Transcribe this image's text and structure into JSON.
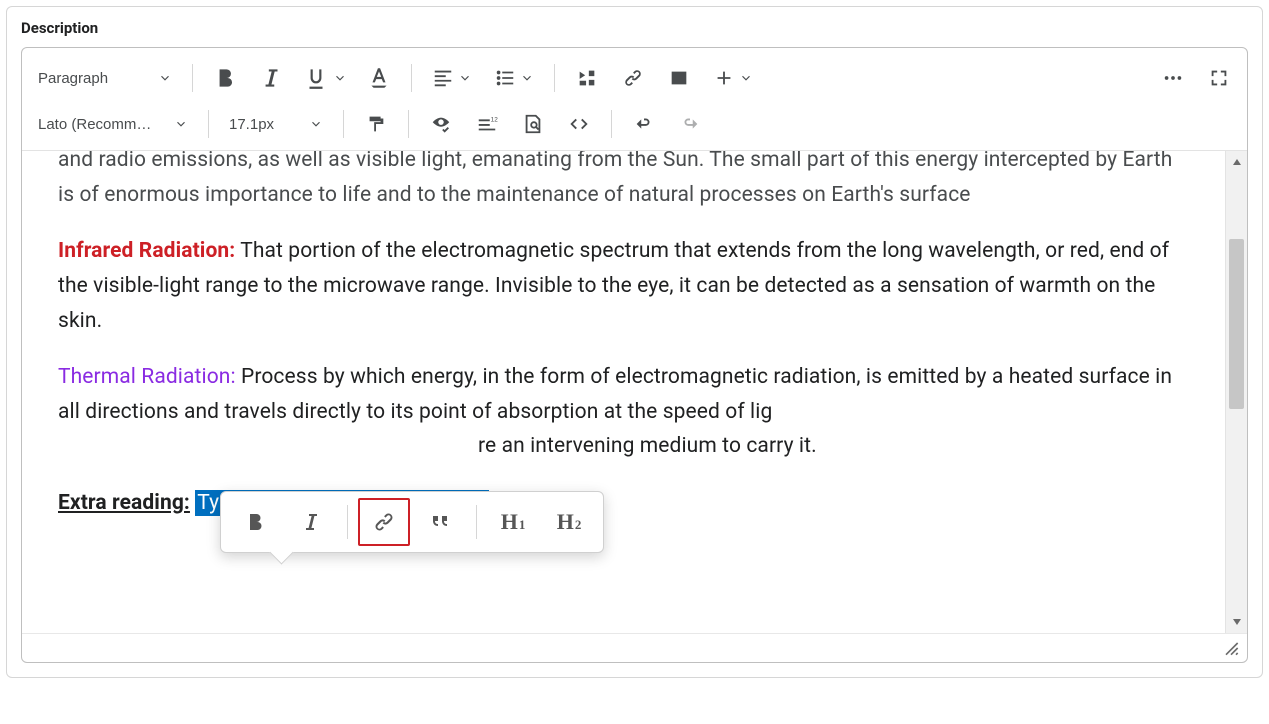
{
  "field_label": "Description",
  "toolbar": {
    "block_format": "Paragraph",
    "font_family": "Lato (Recommended)",
    "font_size": "17.1px"
  },
  "content": {
    "partial_top": "and radio emissions, as well as visible light, emanating from the Sun. The small part of this energy intercepted by Earth is of enormous importance to life and to the maintenance of natural processes on Earth's surface",
    "infrared_label": "Infrared Radiation:",
    "infrared_body": " That portion of the electromagnetic spectrum that extends from the long wavelength, or red, end of the visible-light range to the microwave range. Invisible to the eye, it can be detected as a sensation of warmth on the skin.",
    "thermal_label": "Thermal Radiation:",
    "thermal_body_a": " Process by which energy, in the form of electromagnetic radiation, is emitted by a heated surface in all directions and travels directly to its point of absorption at the speed of lig",
    "thermal_body_b": "re an intervening medium to carry it.",
    "extra_label": "Extra reading:",
    "extra_link": "Types and sources of radiation"
  },
  "float": {
    "h1": "H",
    "h1_sub": "1",
    "h2": "H",
    "h2_sub": "2"
  }
}
